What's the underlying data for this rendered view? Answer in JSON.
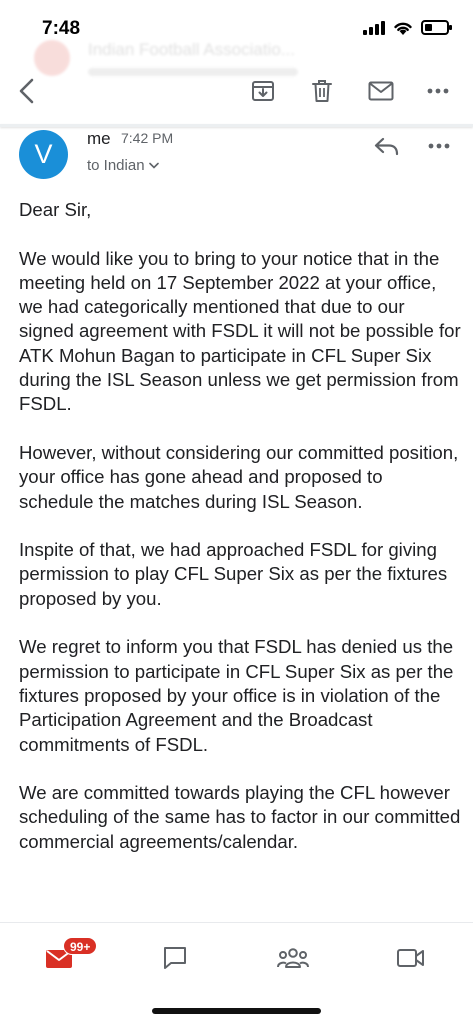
{
  "status_bar": {
    "time": "7:48",
    "battery_level": 0.35
  },
  "background_header": {
    "subject": "Indian Football Associatio..."
  },
  "toolbar": {
    "back_icon": "chevron-left-icon",
    "archive_icon": "archive-icon",
    "delete_icon": "trash-icon",
    "mark_unread_icon": "envelope-icon",
    "more_icon": "more-horiz-icon"
  },
  "message": {
    "avatar_letter": "V",
    "avatar_color": "#1a8fd8",
    "sender": "me",
    "time": "7:42 PM",
    "recipient": "to Indian",
    "greeting": "Dear Sir,",
    "paragraphs": [
      "We would like you to bring to your notice that in the meeting held on 17 September 2022 at your office, we had categorically mentioned that due to our signed agreement with FSDL it will not be possible for ATK Mohun Bagan to participate in CFL Super Six during the ISL Season unless we get permission from FSDL.",
      "However, without considering our committed position, your office has gone ahead and proposed to schedule the matches during ISL Season.",
      "Inspite of that, we had approached FSDL for giving permission to play CFL Super Six as per the fixtures proposed by you.",
      "We regret to inform you that FSDL has denied us the permission to participate in CFL Super Six as per the fixtures proposed by your office is in violation of the Participation Agreement and the Broadcast commitments of FSDL.",
      "We are committed towards playing the CFL however scheduling of the same has to factor in our committed commercial agreements/calendar."
    ]
  },
  "bottom_nav": {
    "mail_badge": "99+",
    "mail_color": "#d93025",
    "items": [
      "mail-icon",
      "chat-icon",
      "spaces-icon",
      "meet-icon"
    ]
  }
}
